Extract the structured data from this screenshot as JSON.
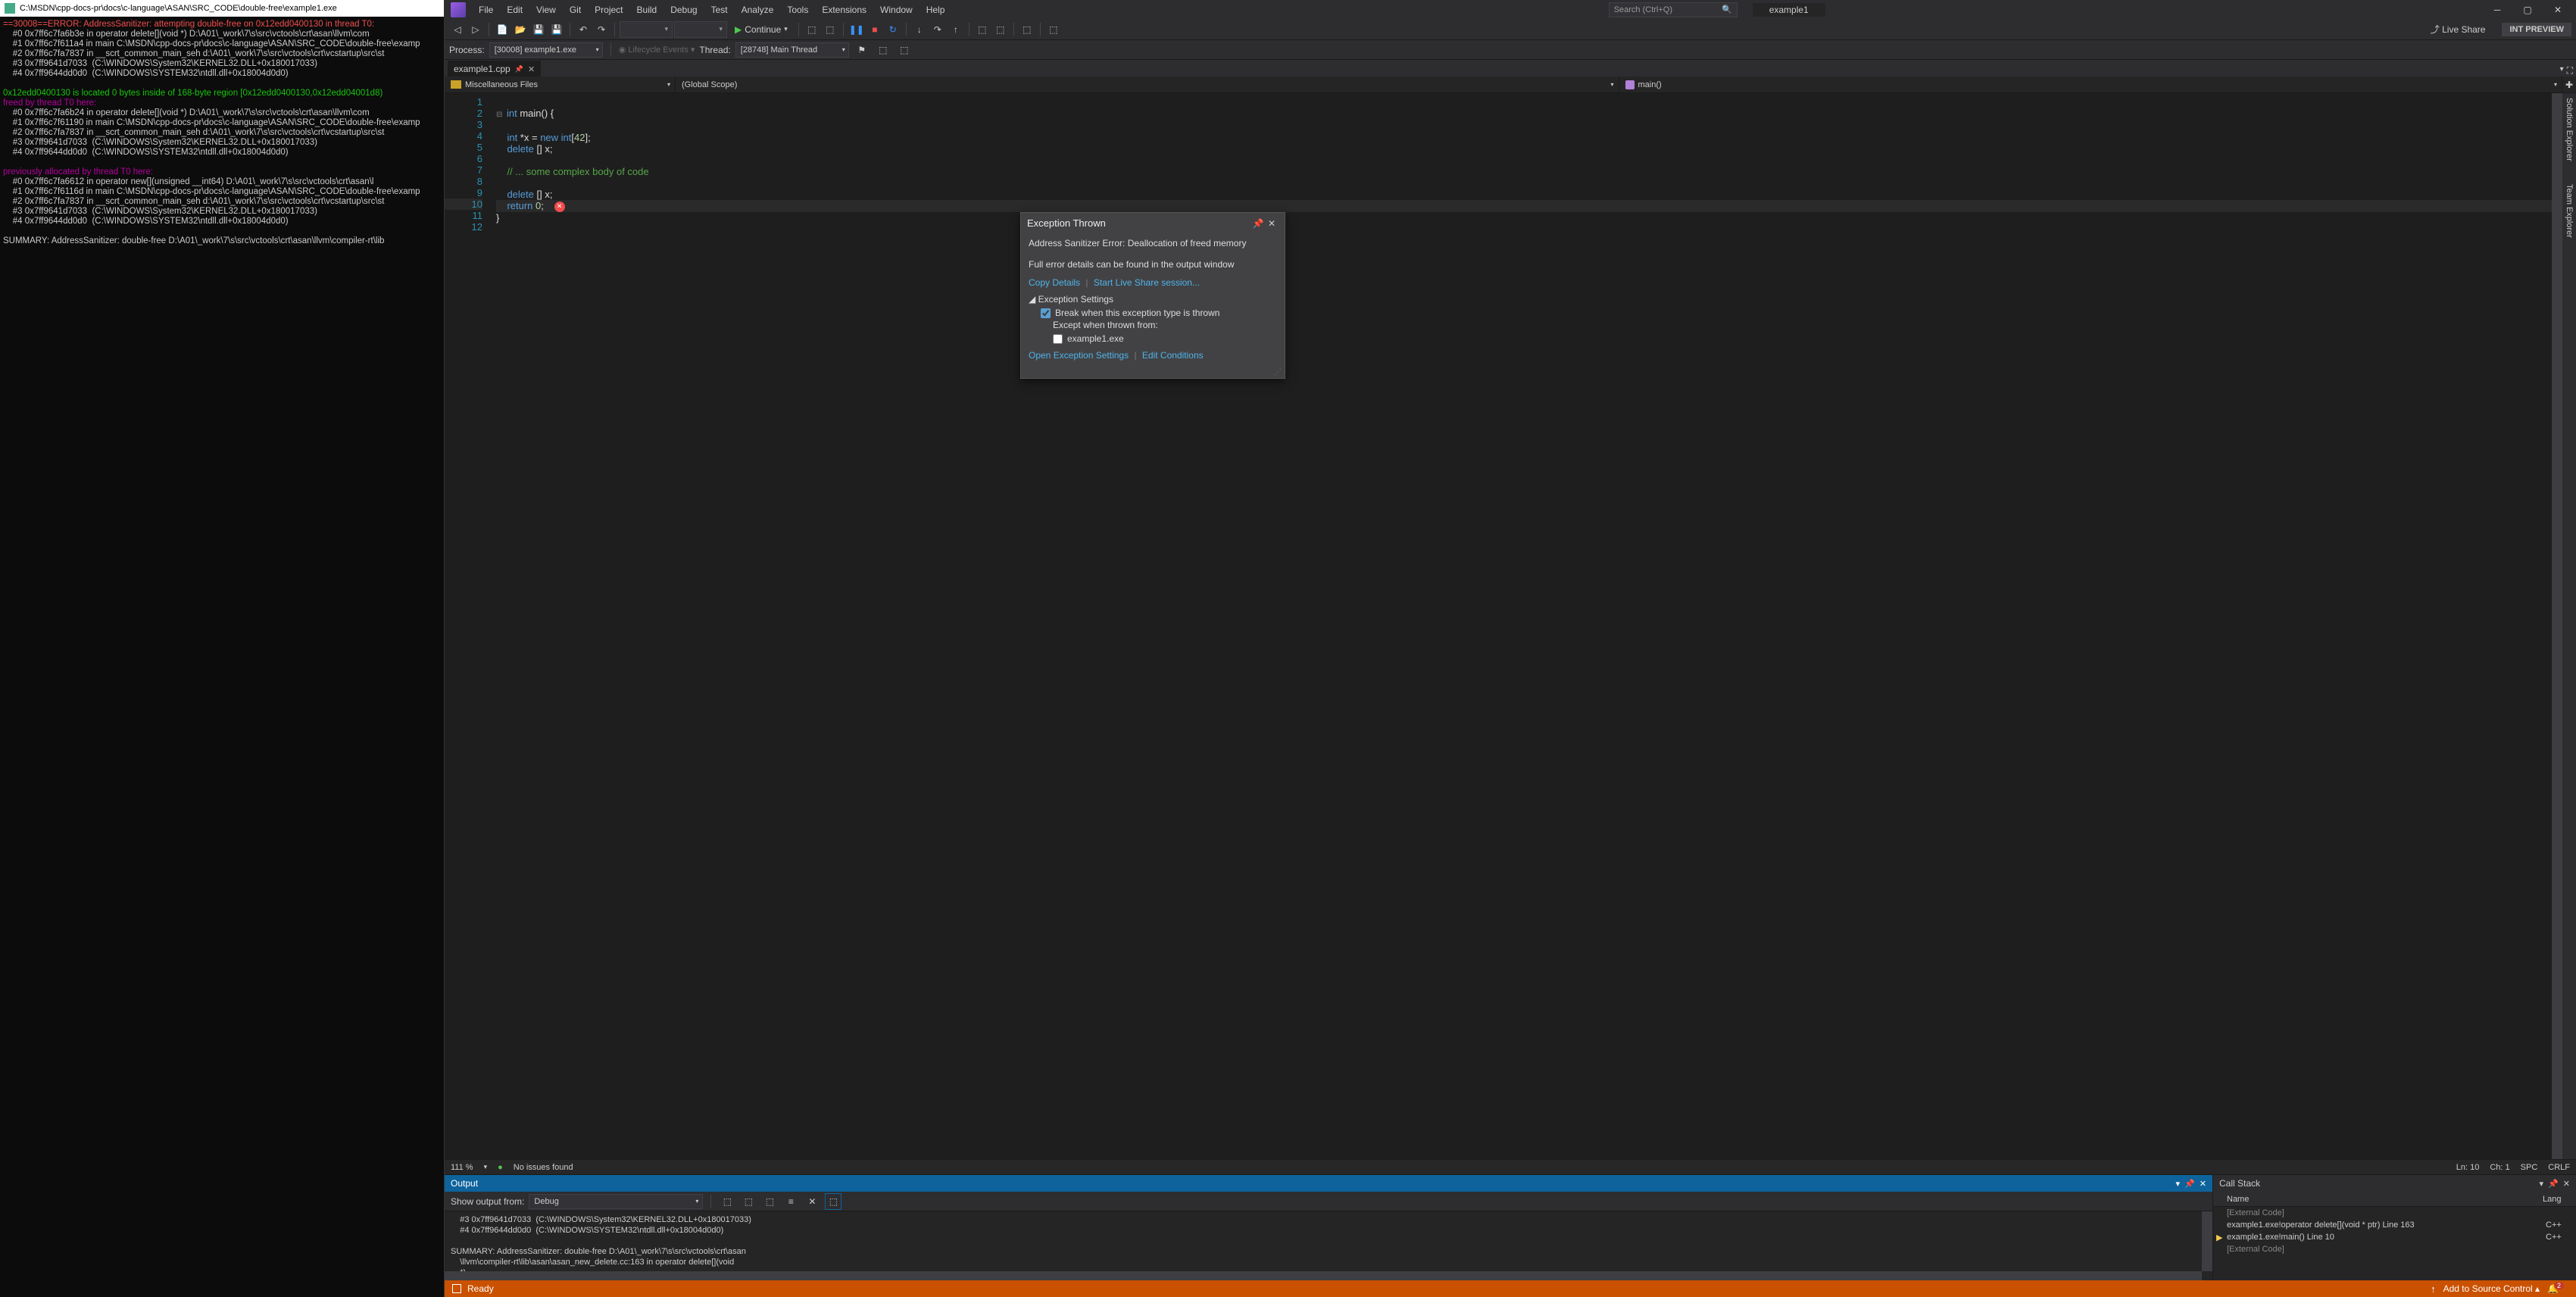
{
  "console": {
    "title": "C:\\MSDN\\cpp-docs-pr\\docs\\c-language\\ASAN\\SRC_CODE\\double-free\\example1.exe",
    "lines": [
      {
        "cls": "err",
        "txt": "==30008==ERROR: AddressSanitizer: attempting double-free on 0x12edd0400130 in thread T0:"
      },
      {
        "cls": "",
        "txt": "    #0 0x7ff6c7fa6b3e in operator delete[](void *) D:\\A01\\_work\\7\\s\\src\\vctools\\crt\\asan\\llvm\\com"
      },
      {
        "cls": "",
        "txt": "    #1 0x7ff6c7f611a4 in main C:\\MSDN\\cpp-docs-pr\\docs\\c-language\\ASAN\\SRC_CODE\\double-free\\examp"
      },
      {
        "cls": "",
        "txt": "    #2 0x7ff6c7fa7837 in __scrt_common_main_seh d:\\A01\\_work\\7\\s\\src\\vctools\\crt\\vcstartup\\src\\st"
      },
      {
        "cls": "",
        "txt": "    #3 0x7ff9641d7033  (C:\\WINDOWS\\System32\\KERNEL32.DLL+0x180017033)"
      },
      {
        "cls": "",
        "txt": "    #4 0x7ff9644dd0d0  (C:\\WINDOWS\\SYSTEM32\\ntdll.dll+0x18004d0d0)"
      },
      {
        "cls": "",
        "txt": ""
      },
      {
        "cls": "grn",
        "txt": "0x12edd0400130 is located 0 bytes inside of 168-byte region [0x12edd0400130,0x12edd04001d8)"
      },
      {
        "cls": "mag",
        "txt": "freed by thread T0 here:"
      },
      {
        "cls": "",
        "txt": "    #0 0x7ff6c7fa6b24 in operator delete[](void *) D:\\A01\\_work\\7\\s\\src\\vctools\\crt\\asan\\llvm\\com"
      },
      {
        "cls": "",
        "txt": "    #1 0x7ff6c7f61190 in main C:\\MSDN\\cpp-docs-pr\\docs\\c-language\\ASAN\\SRC_CODE\\double-free\\examp"
      },
      {
        "cls": "",
        "txt": "    #2 0x7ff6c7fa7837 in __scrt_common_main_seh d:\\A01\\_work\\7\\s\\src\\vctools\\crt\\vcstartup\\src\\st"
      },
      {
        "cls": "",
        "txt": "    #3 0x7ff9641d7033  (C:\\WINDOWS\\System32\\KERNEL32.DLL+0x180017033)"
      },
      {
        "cls": "",
        "txt": "    #4 0x7ff9644dd0d0  (C:\\WINDOWS\\SYSTEM32\\ntdll.dll+0x18004d0d0)"
      },
      {
        "cls": "",
        "txt": ""
      },
      {
        "cls": "mag",
        "txt": "previously allocated by thread T0 here:"
      },
      {
        "cls": "",
        "txt": "    #0 0x7ff6c7fa6612 in operator new[](unsigned __int64) D:\\A01\\_work\\7\\s\\src\\vctools\\crt\\asan\\l"
      },
      {
        "cls": "",
        "txt": "    #1 0x7ff6c7f6116d in main C:\\MSDN\\cpp-docs-pr\\docs\\c-language\\ASAN\\SRC_CODE\\double-free\\examp"
      },
      {
        "cls": "",
        "txt": "    #2 0x7ff6c7fa7837 in __scrt_common_main_seh d:\\A01\\_work\\7\\s\\src\\vctools\\crt\\vcstartup\\src\\st"
      },
      {
        "cls": "",
        "txt": "    #3 0x7ff9641d7033  (C:\\WINDOWS\\System32\\KERNEL32.DLL+0x180017033)"
      },
      {
        "cls": "",
        "txt": "    #4 0x7ff9644dd0d0  (C:\\WINDOWS\\SYSTEM32\\ntdll.dll+0x18004d0d0)"
      },
      {
        "cls": "",
        "txt": ""
      },
      {
        "cls": "",
        "txt": "SUMMARY: AddressSanitizer: double-free D:\\A01\\_work\\7\\s\\src\\vctools\\crt\\asan\\llvm\\compiler-rt\\lib"
      }
    ]
  },
  "menu": {
    "items": [
      "File",
      "Edit",
      "View",
      "Git",
      "Project",
      "Build",
      "Debug",
      "Test",
      "Analyze",
      "Tools",
      "Extensions",
      "Window",
      "Help"
    ]
  },
  "search_placeholder": "Search (Ctrl+Q)",
  "app_title": "example1",
  "toolbar": {
    "continue": "Continue",
    "liveshare": "Live Share",
    "intpreview": "INT PREVIEW"
  },
  "debugbar": {
    "process_lbl": "Process:",
    "process_val": "[30008] example1.exe",
    "lifecycle": "Lifecycle Events",
    "thread_lbl": "Thread:",
    "thread_val": "[28748] Main Thread"
  },
  "tab_name": "example1.cpp",
  "scopes": {
    "left": "Miscellaneous Files",
    "mid": "(Global Scope)",
    "right": "main()"
  },
  "code_lines": [
    "1",
    "2",
    "3",
    "4",
    "5",
    "6",
    "7",
    "8",
    "9",
    "10",
    "11",
    "12"
  ],
  "code": {
    "l2a": "int",
    "l2b": " main() {",
    "l4a": "int",
    "l4b": " *x = ",
    "l4c": "new",
    "l4d": " int",
    "l4e": "[",
    "l4f": "42",
    "l4g": "];",
    "l5a": "delete",
    "l5b": " [] x;",
    "l7": "// ... some complex body of code",
    "l9a": "delete",
    "l9b": " [] x;",
    "l10a": "return",
    "l10b": " ",
    "l10c": "0",
    "l10d": ";",
    "l11": "}"
  },
  "exc": {
    "title": "Exception Thrown",
    "msg": "Address Sanitizer Error: Deallocation of freed memory",
    "sub": "Full error details can be found in the output window",
    "copy": "Copy Details",
    "live": "Start Live Share session...",
    "settings_hdr": "Exception Settings",
    "cb1": "Break when this exception type is thrown",
    "except": "Except when thrown from:",
    "cb2": "example1.exe",
    "open": "Open Exception Settings",
    "edit": "Edit Conditions"
  },
  "editor_status": {
    "zoom": "111 %",
    "issues": "No issues found",
    "ln": "Ln: 10",
    "ch": "Ch: 1",
    "spc": "SPC",
    "crlf": "CRLF"
  },
  "output": {
    "title": "Output",
    "from_lbl": "Show output from:",
    "from_val": "Debug",
    "body": "    #3 0x7ff9641d7033  (C:\\WINDOWS\\System32\\KERNEL32.DLL+0x180017033)\n    #4 0x7ff9644dd0d0  (C:\\WINDOWS\\SYSTEM32\\ntdll.dll+0x18004d0d0)\n\nSUMMARY: AddressSanitizer: double-free D:\\A01\\_work\\7\\s\\src\\vctools\\crt\\asan\n    \\llvm\\compiler-rt\\lib\\asan\\asan_new_delete.cc:163 in operator delete[](void\n    *)\n\nAddress Sanitizer Error: Deallocation of freed memory"
  },
  "callstack": {
    "title": "Call Stack",
    "col_name": "Name",
    "col_lang": "Lang",
    "rows": [
      {
        "arrow": "",
        "name": "[External Code]",
        "lang": "",
        "ext": true
      },
      {
        "arrow": "",
        "name": "example1.exe!operator delete[](void * ptr) Line 163",
        "lang": "C++",
        "ext": false
      },
      {
        "arrow": "▶",
        "name": "example1.exe!main() Line 10",
        "lang": "C++",
        "ext": false
      },
      {
        "arrow": "",
        "name": "[External Code]",
        "lang": "",
        "ext": true
      }
    ]
  },
  "rail": {
    "sol": "Solution Explorer",
    "team": "Team Explorer"
  },
  "statusbar": {
    "ready": "Ready",
    "addsrc": "Add to Source Control",
    "notif_count": "2"
  }
}
